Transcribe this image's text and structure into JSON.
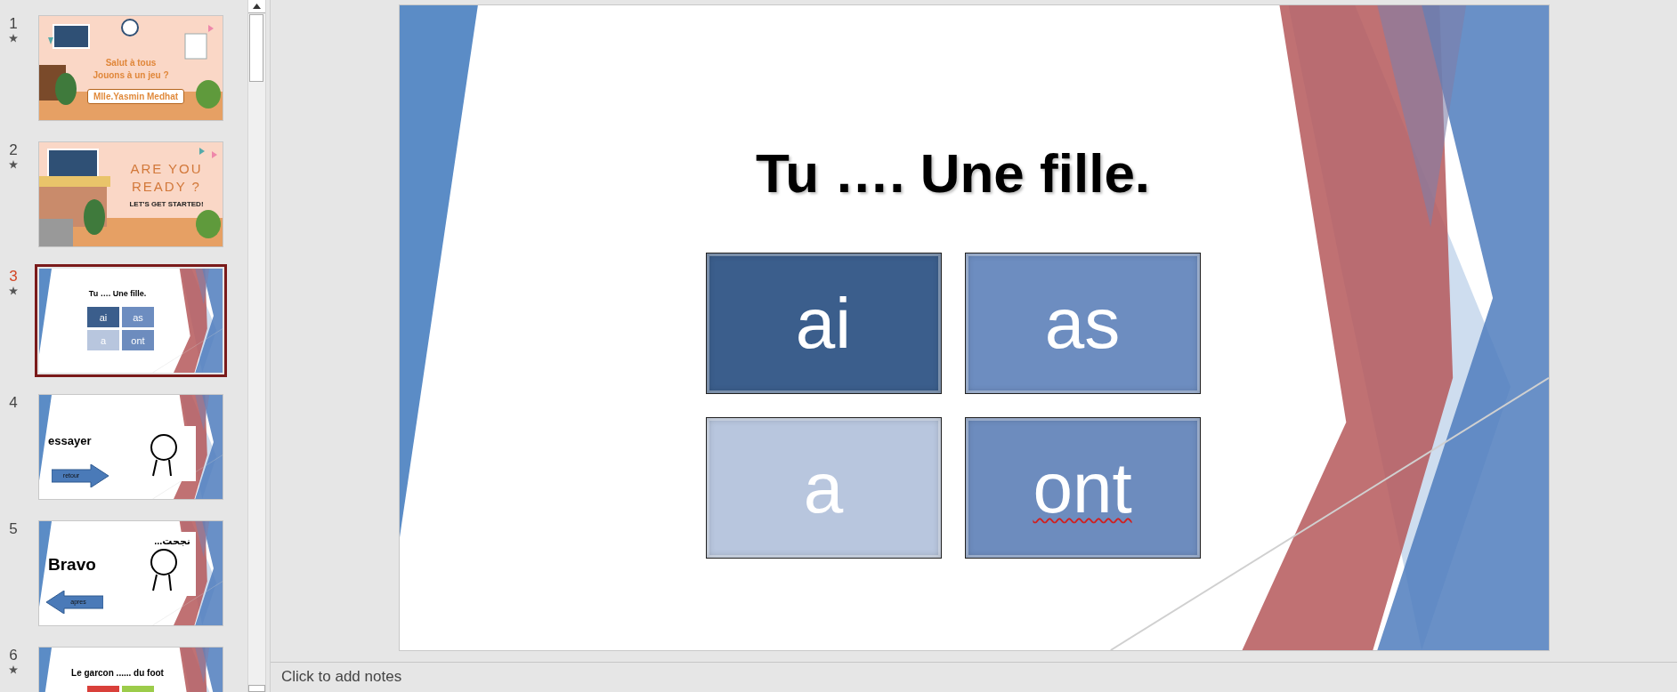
{
  "slide_panel": {
    "slides": [
      {
        "number": "1",
        "animated": true,
        "selected": false,
        "kind": "welcome",
        "lines": [
          "Salut à tous",
          "Jouons à un jeu ?"
        ],
        "badge": "Mlle.Yasmin Medhat"
      },
      {
        "number": "2",
        "animated": true,
        "selected": false,
        "kind": "ready",
        "lines": [
          "ARE YOU",
          "READY ?"
        ],
        "subtitle": "LET'S GET STARTED!"
      },
      {
        "number": "3",
        "animated": true,
        "selected": true,
        "kind": "quiz",
        "title": "Tu …. Une fille.",
        "options": [
          {
            "label": "ai",
            "color": "#3b5e8c"
          },
          {
            "label": "as",
            "color": "#6d8dc0"
          },
          {
            "label": "a",
            "color": "#b8c6de"
          },
          {
            "label": "ont",
            "color": "#6d8cbe"
          }
        ]
      },
      {
        "number": "4",
        "animated": false,
        "selected": false,
        "kind": "feedback",
        "word": "essayer",
        "arrow": {
          "label": "retour",
          "kind": "right"
        }
      },
      {
        "number": "5",
        "animated": false,
        "selected": false,
        "kind": "feedback",
        "word": "Bravo",
        "caption": "نجحت...",
        "arrow": {
          "label": "apres",
          "kind": "left"
        }
      },
      {
        "number": "6",
        "animated": true,
        "selected": false,
        "kind": "quiz",
        "title": "Le garcon ...... du foot",
        "options": [
          {
            "color": "#d9403a"
          },
          {
            "color": "#9ccc4a"
          }
        ]
      }
    ]
  },
  "slide": {
    "title": "Tu …. Une fille.",
    "options": [
      {
        "label": "ai",
        "color": "#3b5e8c",
        "flagged": false
      },
      {
        "label": "as",
        "color": "#6d8dc0",
        "flagged": false
      },
      {
        "label": "a",
        "color": "#b8c6de",
        "flagged": false
      },
      {
        "label": "ont",
        "color": "#6d8cbe",
        "flagged": true
      }
    ]
  },
  "notes": {
    "placeholder": "Click to add notes"
  }
}
